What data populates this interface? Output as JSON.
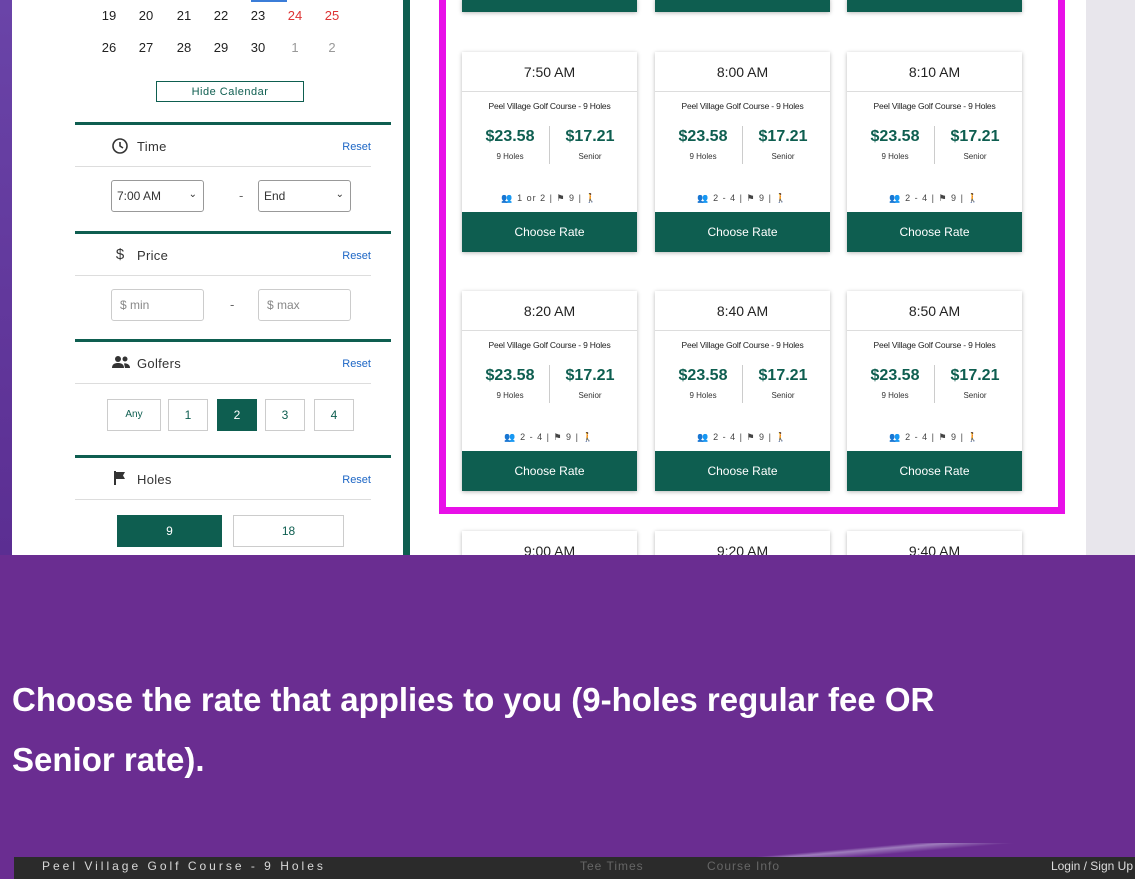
{
  "calendar": {
    "rows": [
      [
        {
          "d": "19",
          "k": ""
        },
        {
          "d": "20",
          "k": ""
        },
        {
          "d": "21",
          "k": ""
        },
        {
          "d": "22",
          "k": ""
        },
        {
          "d": "23",
          "k": ""
        },
        {
          "d": "24",
          "k": "we"
        },
        {
          "d": "25",
          "k": "we"
        }
      ],
      [
        {
          "d": "26",
          "k": ""
        },
        {
          "d": "27",
          "k": ""
        },
        {
          "d": "28",
          "k": ""
        },
        {
          "d": "29",
          "k": ""
        },
        {
          "d": "30",
          "k": ""
        },
        {
          "d": "1",
          "k": "dim"
        },
        {
          "d": "2",
          "k": "dim"
        }
      ]
    ],
    "hide_label": "Hide Calendar"
  },
  "filters": {
    "time": {
      "title": "Time",
      "reset": "Reset",
      "from": "7:00 AM",
      "to": "End",
      "sep": "-"
    },
    "price": {
      "title": "Price",
      "reset": "Reset",
      "min": "$  min",
      "max": "$  max",
      "sep": "-"
    },
    "golfers": {
      "title": "Golfers",
      "reset": "Reset",
      "options": [
        "Any",
        "1",
        "2",
        "3",
        "4"
      ],
      "selected": "2"
    },
    "holes": {
      "title": "Holes",
      "reset": "Reset",
      "options": [
        "9",
        "18"
      ],
      "selected": "9"
    }
  },
  "cards": [
    {
      "time": "7:50 AM",
      "course": "Peel Village Golf Course - 9 Holes",
      "price1": "$23.58",
      "label1": "9 Holes",
      "price2": "$17.21",
      "label2": "Senior",
      "golfers": "1 or 2",
      "holes": "9",
      "button": "Choose Rate"
    },
    {
      "time": "8:00 AM",
      "course": "Peel Village Golf Course - 9 Holes",
      "price1": "$23.58",
      "label1": "9 Holes",
      "price2": "$17.21",
      "label2": "Senior",
      "golfers": "2 - 4",
      "holes": "9",
      "button": "Choose Rate"
    },
    {
      "time": "8:10 AM",
      "course": "Peel Village Golf Course - 9 Holes",
      "price1": "$23.58",
      "label1": "9 Holes",
      "price2": "$17.21",
      "label2": "Senior",
      "golfers": "2 - 4",
      "holes": "9",
      "button": "Choose Rate"
    },
    {
      "time": "8:20 AM",
      "course": "Peel Village Golf Course - 9 Holes",
      "price1": "$23.58",
      "label1": "9 Holes",
      "price2": "$17.21",
      "label2": "Senior",
      "golfers": "2 - 4",
      "holes": "9",
      "button": "Choose Rate"
    },
    {
      "time": "8:40 AM",
      "course": "Peel Village Golf Course - 9 Holes",
      "price1": "$23.58",
      "label1": "9 Holes",
      "price2": "$17.21",
      "label2": "Senior",
      "golfers": "2 - 4",
      "holes": "9",
      "button": "Choose Rate"
    },
    {
      "time": "8:50 AM",
      "course": "Peel Village Golf Course - 9 Holes",
      "price1": "$23.58",
      "label1": "9 Holes",
      "price2": "$17.21",
      "label2": "Senior",
      "golfers": "2 - 4",
      "holes": "9",
      "button": "Choose Rate"
    },
    {
      "time": "9:00 AM"
    },
    {
      "time": "9:20 AM"
    },
    {
      "time": "9:40 AM"
    }
  ],
  "caption": {
    "line1": "Choose the rate that applies to you (9-holes regular fee OR",
    "line2": "Senior rate)."
  },
  "footer": {
    "site_title": "Peel Village Golf Course - 9 Holes",
    "nav1": "Tee Times",
    "nav2": "Course Info",
    "login": "Login / Sign Up"
  },
  "colors": {
    "brand": "#0e5e50",
    "highlight": "#e810e8",
    "slide_bg": "#6a2d91",
    "weekend": "#dd3333"
  }
}
